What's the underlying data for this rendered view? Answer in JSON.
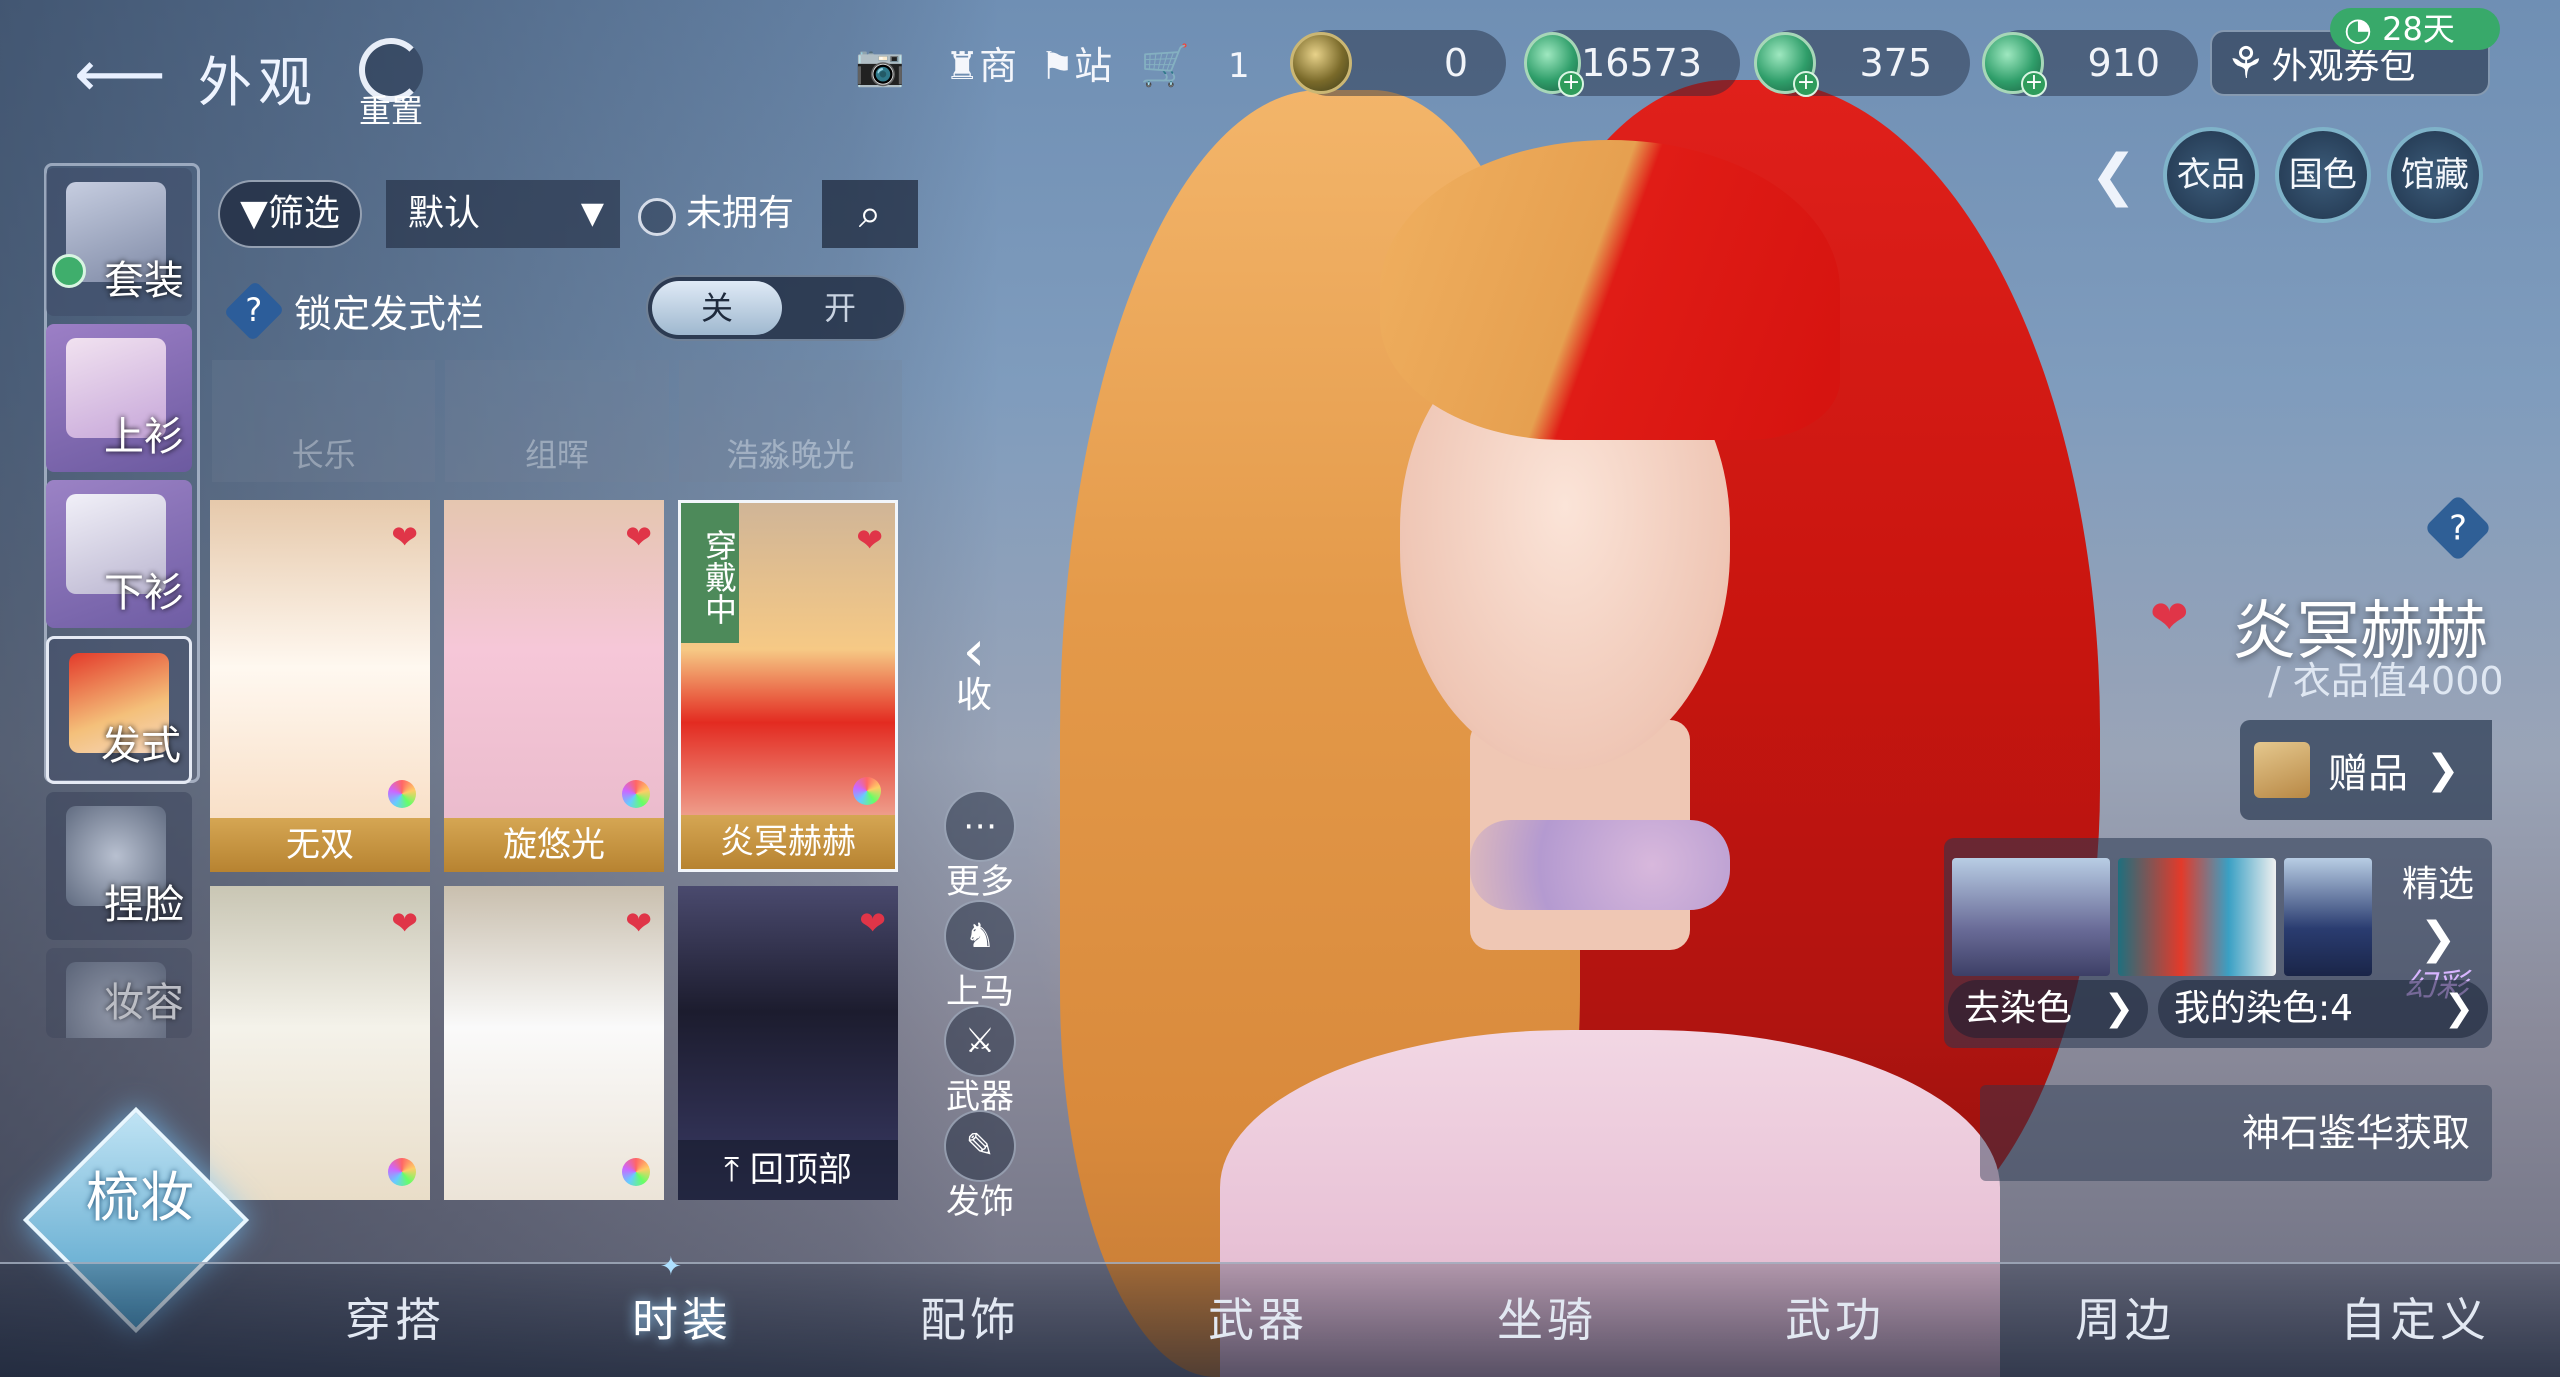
{
  "header": {
    "title": "外观",
    "reset_label": "重置",
    "icons": [
      "camera-icon",
      "shop-icon",
      "station-icon",
      "cart-icon"
    ],
    "shop_label": "商",
    "station_label": "站",
    "cart_count": "1",
    "currencies": [
      {
        "name": "gem-currency",
        "value": "0"
      },
      {
        "name": "jade-currency-1",
        "value": "16573"
      },
      {
        "name": "jade-currency-2",
        "value": "375"
      },
      {
        "name": "jade-currency-3",
        "value": "910"
      }
    ],
    "voucher_label": "外观券包",
    "voucher_days": "28天"
  },
  "right_tabs": [
    "衣品",
    "国色",
    "馆藏"
  ],
  "sidebar": {
    "items": [
      {
        "label": "套装"
      },
      {
        "label": "上衫"
      },
      {
        "label": "下衫"
      },
      {
        "label": "发式"
      },
      {
        "label": "捏脸"
      },
      {
        "label": "妆容"
      }
    ]
  },
  "filters": {
    "filter_label": "筛选",
    "sort_value": "默认",
    "unowned_label": "未拥有"
  },
  "lock_row": {
    "label": "锁定发式栏",
    "off": "关",
    "on": "开"
  },
  "ghost_row": [
    "长乐",
    "组晖",
    "浩淼晚光"
  ],
  "cards": [
    {
      "name": "无双"
    },
    {
      "name": "旋悠光"
    },
    {
      "name": "炎冥赫赫",
      "badge": "穿戴中"
    },
    {
      "name": ""
    },
    {
      "name": ""
    },
    {
      "name": ""
    }
  ],
  "back_to_top": "回顶部",
  "tools": {
    "collapse": "收",
    "more": "更多",
    "mount": "上马",
    "weapon": "武器",
    "hair_accessory": "发饰"
  },
  "item": {
    "name": "炎冥赫赫",
    "value": "/ 衣品值4000",
    "gift_label": "赠品",
    "featured_label": "精选",
    "huancai": "幻彩",
    "go_dye": "去染色",
    "my_dye": "我的染色:4",
    "stone_link": "神石鉴华获取"
  },
  "bottom_nav": [
    "穿搭",
    "时装",
    "配饰",
    "武器",
    "坐骑",
    "武功",
    "周边",
    "自定义"
  ],
  "bottom_nav_active": "时装",
  "makeup_label": "梳妆",
  "colors": {
    "accent_green": "#38a96a",
    "heart_red": "#e03548",
    "nameplate_gold": "#c9953f"
  }
}
